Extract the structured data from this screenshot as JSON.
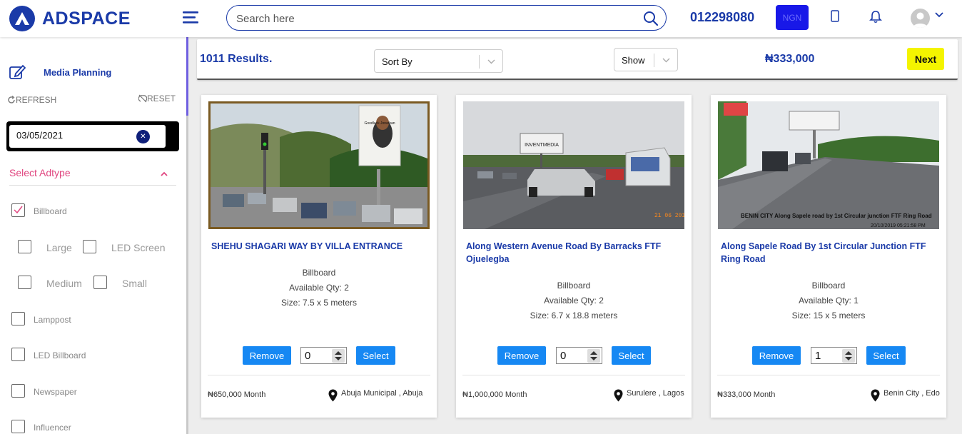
{
  "header": {
    "brand": "ADSPACE",
    "search_placeholder": "Search here",
    "phone": "012298080",
    "currency": "NGN"
  },
  "sidebar": {
    "media_planning": "Media Planning",
    "refresh": "REFRESH",
    "reset": "RESET",
    "date_value": "03/05/2021",
    "adtype_label": "Select Adtype",
    "options": {
      "billboard": {
        "label": "Billboard",
        "checked": true
      },
      "large": {
        "label": "Large",
        "checked": false
      },
      "led_screen": {
        "label": "LED Screen",
        "checked": false
      },
      "medium": {
        "label": "Medium",
        "checked": false
      },
      "small": {
        "label": "Small",
        "checked": false
      },
      "lamppost": {
        "label": "Lamppost",
        "checked": false
      },
      "led_billboard": {
        "label": "LED Billboard",
        "checked": false
      },
      "newspaper": {
        "label": "Newspaper",
        "checked": false
      },
      "influencer": {
        "label": "Influencer",
        "checked": false
      }
    }
  },
  "toolbar": {
    "results": "1011 Results.",
    "sort_by": "Sort By",
    "show": "Show",
    "total": "₦333,000",
    "next": "Next"
  },
  "cards": [
    {
      "title": "SHEHU SHAGARI WAY BY VILLA ENTRANCE",
      "type": "Billboard",
      "qty": "Available Qty: 2",
      "size": "Size: 7.5 x 5 meters",
      "remove": "Remove",
      "quantity": "0",
      "select": "Select",
      "price": "₦650,000 Month",
      "location": "Abuja Municipal , Abuja",
      "billboard_text": "Goodluck Jonathan"
    },
    {
      "title": "Along Western Avenue Road By Barracks FTF Ojuelegba",
      "type": "Billboard",
      "qty": "Available Qty: 2",
      "size": "Size: 6.7 x 18.8 meters",
      "remove": "Remove",
      "quantity": "0",
      "select": "Select",
      "price": "₦1,000,000 Month",
      "location": "Surulere , Lagos",
      "billboard_text": "INVENTMEDIA",
      "photo_date": "21 06 2018"
    },
    {
      "title": "Along Sapele Road By 1st Circular Junction FTF Ring Road",
      "type": "Billboard",
      "qty": "Available Qty: 1",
      "size": "Size: 15 x 5 meters",
      "remove": "Remove",
      "quantity": "1",
      "select": "Select",
      "price": "₦333,000 Month",
      "location": "Benin City , Edo",
      "caption": "BENIN CITY Along Sapele road by 1st Circular junction FTF Ring Road",
      "photo_date": "20/10/2019 05:21:58 PM"
    }
  ],
  "colors": {
    "brand": "#1a3aa8",
    "button": "#1688f3",
    "next": "#f4f400",
    "adtype": "#e0457f"
  }
}
